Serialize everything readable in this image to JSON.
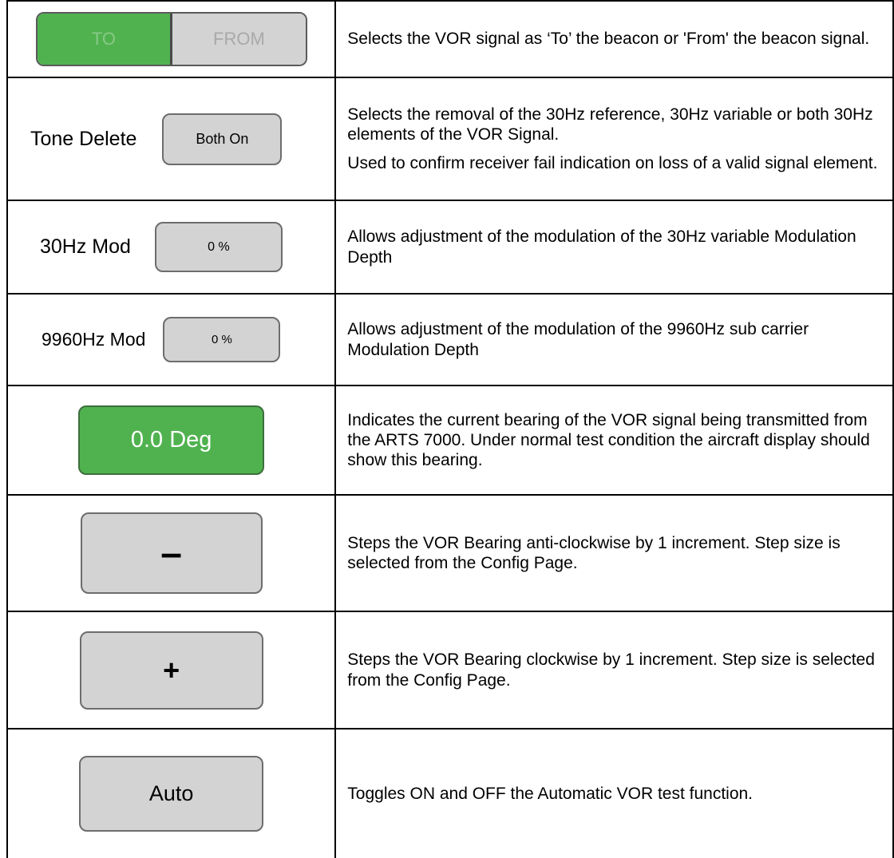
{
  "rows": [
    {
      "control": {
        "to_label": "TO",
        "from_label": "FROM"
      },
      "desc": [
        "Selects the VOR signal as ‘To’ the beacon or 'From' the beacon signal."
      ]
    },
    {
      "control": {
        "label": "Tone Delete",
        "button": "Both On"
      },
      "desc": [
        "Selects the removal of the 30Hz reference, 30Hz variable or both 30Hz elements of the VOR Signal.",
        "Used to confirm receiver fail indication on loss of a valid signal element."
      ]
    },
    {
      "control": {
        "label": "30Hz Mod",
        "button": "0 %"
      },
      "desc": [
        "Allows adjustment of the modulation of the 30Hz variable Modulation Depth"
      ]
    },
    {
      "control": {
        "label": "9960Hz Mod",
        "button": "0 %"
      },
      "desc": [
        "Allows adjustment of the modulation of the 9960Hz sub carrier Modulation Depth"
      ]
    },
    {
      "control": {
        "button": "0.0 Deg",
        "color": "#50b24f"
      },
      "desc": [
        "Indicates the current bearing of the VOR signal being transmitted from the ARTS 7000. Under normal test condition the aircraft display should show this bearing."
      ]
    },
    {
      "control": {
        "button": "–"
      },
      "desc": [
        "Steps the VOR Bearing anti-clockwise by 1 increment. Step size is selected from the Config Page."
      ]
    },
    {
      "control": {
        "button": "+"
      },
      "desc": [
        "Steps the VOR Bearing clockwise by 1 increment. Step size is selected from the Config Page."
      ]
    },
    {
      "control": {
        "button": "Auto"
      },
      "desc": [
        "Toggles ON and OFF the Automatic VOR test function."
      ]
    }
  ]
}
